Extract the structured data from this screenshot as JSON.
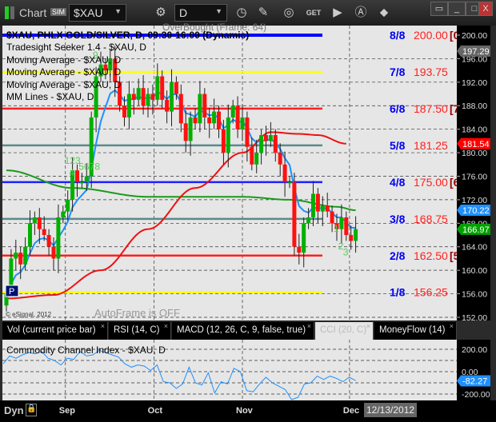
{
  "window": {
    "title": "Chart",
    "sim_badge": "SIM",
    "symbol": "$XAU",
    "interval": "D",
    "controls": {
      "minimize": "_",
      "maximize": "□",
      "close": "X"
    }
  },
  "toolbar_icons": [
    "gear-icon",
    "clock-icon",
    "pencil-icon",
    "study-icon",
    "get-icon",
    "play-icon",
    "a-icon",
    "link-icon"
  ],
  "chart": {
    "header": "$XAU, PHLX GOLD/SILVER, D, 09:30-16:00 (Dynamic)",
    "overbought": "OverBought (Frame: 64)",
    "studies": [
      "Tradesight Seeker 1.4 - $XAU, D",
      "Moving Average - $XAU, D",
      "Moving Average - $XAU, D",
      "Moving Average - $XAU, D",
      "MM Lines - $XAU, D"
    ],
    "copyright": "© eSignal, 2012",
    "autoframe": "AutoFrame is OFF",
    "p_marker": "P",
    "mm_lines": [
      {
        "label": "8/8",
        "value": "200.00",
        "bracket": "[0",
        "price": 200,
        "color": "#0000ff"
      },
      {
        "label": "7/8",
        "value": "193.75",
        "bracket": "",
        "price": 193.75,
        "color": "#ffff00"
      },
      {
        "label": "6/8",
        "value": "187.50",
        "bracket": "[7",
        "price": 187.5,
        "color": "#ff2020"
      },
      {
        "label": "5/8",
        "value": "181.25",
        "bracket": "",
        "price": 181.25,
        "color": "#5a8a8a"
      },
      {
        "label": "4/8",
        "value": "175.00",
        "bracket": "[6",
        "price": 175,
        "color": "#2020ff"
      },
      {
        "label": "3/8",
        "value": "168.75",
        "bracket": "",
        "price": 168.75,
        "color": "#5a8a8a"
      },
      {
        "label": "2/8",
        "value": "162.50",
        "bracket": "[5",
        "price": 162.5,
        "color": "#ff2020"
      },
      {
        "label": "1/8",
        "value": "156.25",
        "bracket": "",
        "price": 156.25,
        "color": "#ffff00"
      }
    ],
    "price_ticks": [
      "200.00",
      "196.00",
      "192.00",
      "188.00",
      "184.00",
      "180.00",
      "176.00",
      "172.00",
      "168.00",
      "164.00",
      "160.00",
      "156.00",
      "152.00"
    ],
    "price_tags": [
      {
        "value": "197.29",
        "color": "#666666"
      },
      {
        "value": "181.54",
        "color": "#ff0000"
      },
      {
        "value": "170.22",
        "color": "#1e90ff"
      },
      {
        "value": "166.97",
        "color": "#00a000"
      }
    ],
    "seeker_labels": [
      {
        "text": "123",
        "bar": 14
      },
      {
        "text": "4",
        "bar": 15
      },
      {
        "text": "5678",
        "bar": 17
      },
      {
        "text": "9",
        "bar": 20
      },
      {
        "text": "1",
        "bar": 71
      },
      {
        "text": "2",
        "bar": 72
      },
      {
        "text": "3",
        "bar": 73
      }
    ],
    "xaxis": [
      "Sep",
      "Oct",
      "Nov",
      "Dec"
    ],
    "date_badge": "12/13/2012",
    "dyn_label": "Dyn"
  },
  "chart_data": {
    "type": "candlestick",
    "ylim": [
      152,
      200
    ],
    "closes": [
      156,
      162,
      163,
      161,
      164,
      168,
      169,
      167,
      166,
      164,
      162,
      169,
      170,
      172,
      177,
      175,
      175,
      176,
      186,
      193,
      195,
      194,
      196,
      192,
      188,
      186,
      190,
      189,
      191,
      188,
      190,
      189,
      193,
      189,
      187,
      192,
      190,
      185,
      182,
      186,
      185,
      190,
      186,
      185,
      187,
      184,
      180,
      186,
      188,
      184,
      186,
      181,
      178,
      180,
      183,
      182,
      183,
      180,
      178,
      175,
      175,
      164,
      163,
      168,
      169,
      173,
      170,
      171,
      170,
      168,
      167,
      169,
      166,
      165,
      167
    ],
    "opens": [
      154,
      157,
      162,
      163,
      161,
      164,
      168,
      169,
      167,
      166,
      164,
      162,
      169,
      170,
      172,
      177,
      175,
      175,
      176,
      186,
      193,
      195,
      194,
      196,
      192,
      188,
      186,
      190,
      189,
      191,
      188,
      190,
      189,
      193,
      189,
      187,
      192,
      190,
      185,
      182,
      186,
      185,
      190,
      186,
      185,
      187,
      184,
      180,
      186,
      188,
      184,
      186,
      181,
      178,
      180,
      183,
      182,
      183,
      180,
      178,
      175,
      175,
      164,
      163,
      168,
      169,
      173,
      170,
      171,
      170,
      168,
      167,
      169,
      166,
      165
    ],
    "red_ma": [
      [
        0,
        155.2
      ],
      [
        10,
        155.8
      ],
      [
        20,
        160
      ],
      [
        30,
        167
      ],
      [
        40,
        174
      ],
      [
        50,
        180
      ],
      [
        56,
        183.5
      ],
      [
        62,
        183.2
      ],
      [
        66,
        183
      ],
      [
        72,
        181.54
      ]
    ],
    "green_ma": [
      [
        0,
        177
      ],
      [
        14,
        174
      ],
      [
        30,
        172.5
      ],
      [
        50,
        172.5
      ],
      [
        60,
        172
      ],
      [
        70,
        170.8
      ],
      [
        74,
        170.22
      ]
    ],
    "xtick_bars": {
      "Sep": 12.5,
      "Oct": 31.3,
      "Nov": 50,
      "Dec": 72.7
    }
  },
  "cci": {
    "title": "Commodity Channel Index - $XAU, D",
    "ticks": [
      "200.00",
      "0.00",
      "-200.00"
    ],
    "current": "-82.27",
    "values": [
      70,
      140,
      120,
      150,
      170,
      160,
      180,
      120,
      100,
      60,
      120,
      110,
      180,
      140,
      150,
      190,
      170,
      150,
      130,
      70,
      40,
      60,
      50,
      10,
      60,
      -90,
      -100,
      -150,
      -110,
      40,
      -100,
      -120,
      -10,
      -190,
      -90,
      -110,
      30,
      0,
      -170,
      -180,
      -110,
      -50,
      -100,
      -130,
      -160,
      -250,
      -230,
      -110,
      -100,
      -40,
      -70,
      -40,
      -60,
      -90,
      -50,
      -80
    ]
  },
  "tabs": [
    {
      "label": "Vol (current price bar)"
    },
    {
      "label": "RSI (14, C)"
    },
    {
      "label": "MACD (12, 26, C, 9, false, true)"
    },
    {
      "label": "CCI (20, C)",
      "active": true
    },
    {
      "label": "MoneyFlow (14)"
    }
  ]
}
